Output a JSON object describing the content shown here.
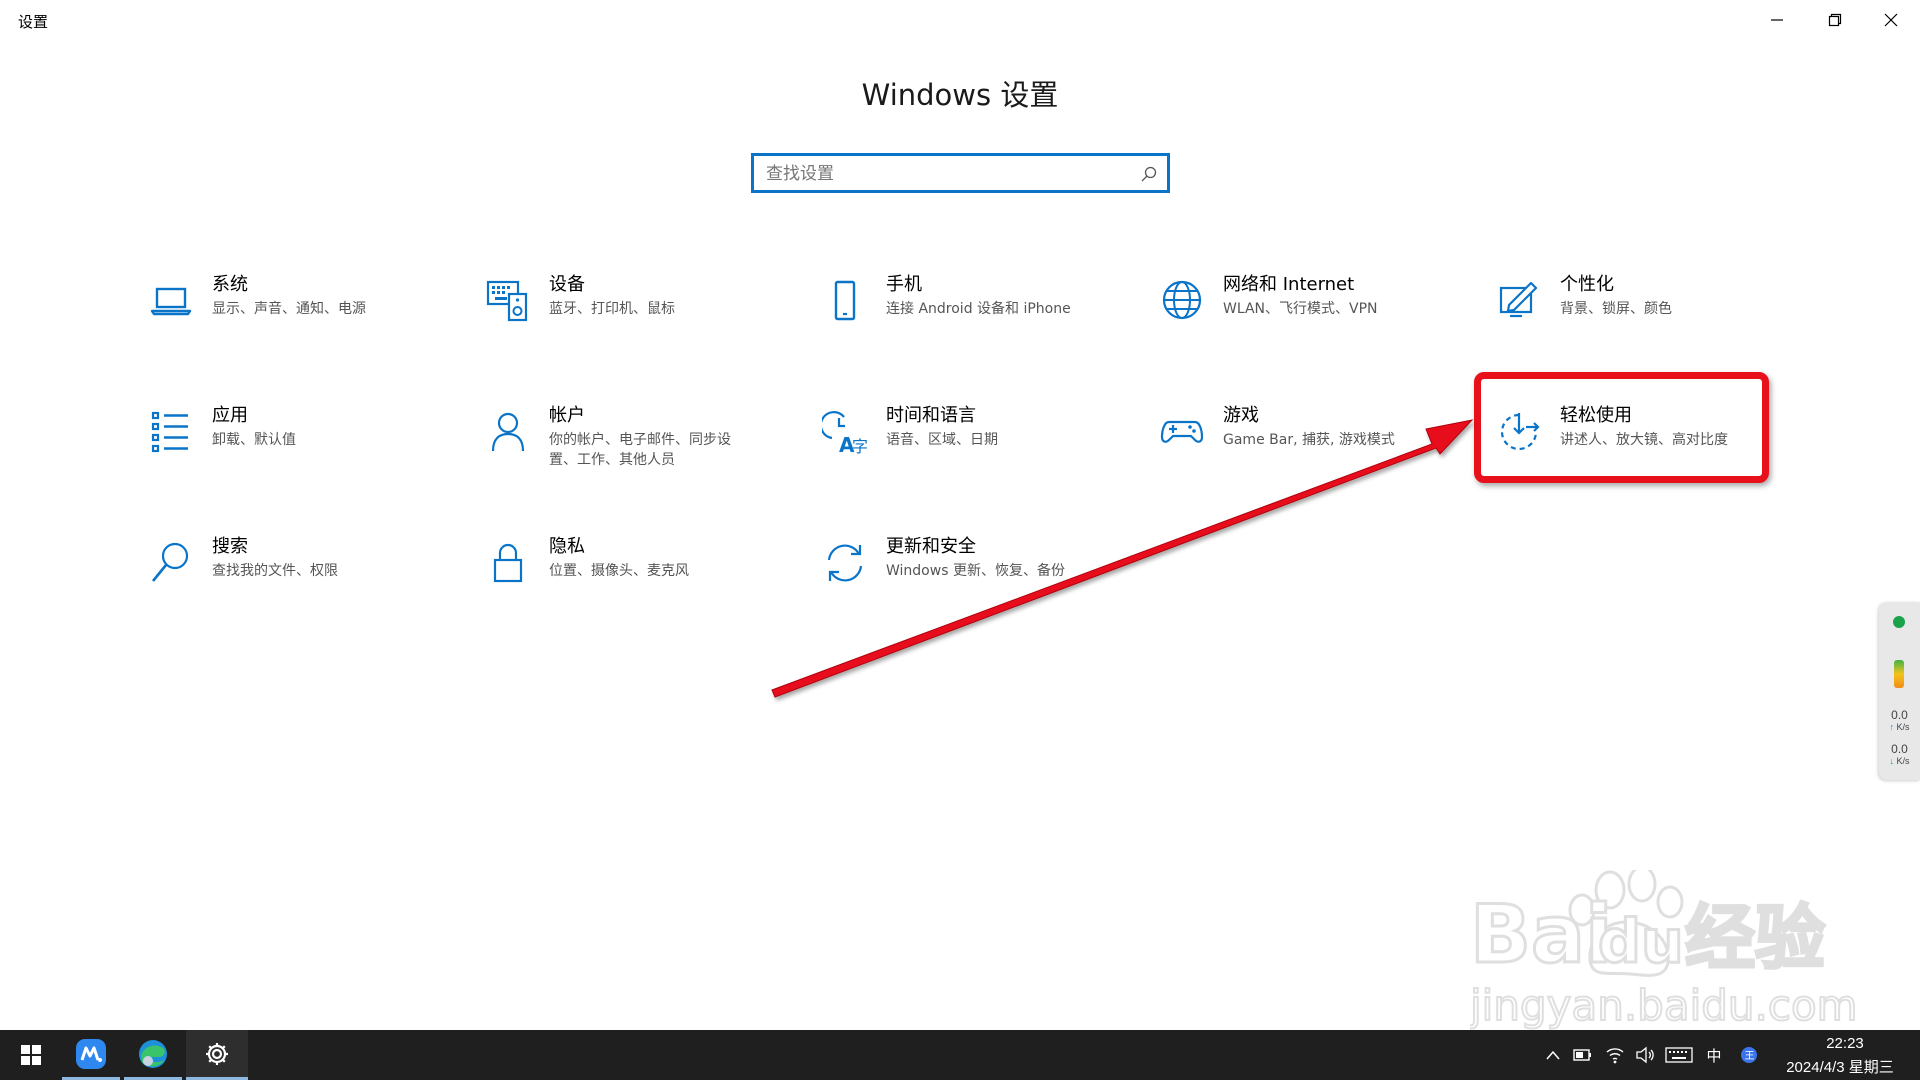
{
  "window": {
    "title": "设置"
  },
  "header": {
    "title": "Windows 设置"
  },
  "search": {
    "placeholder": "查找设置"
  },
  "categories": [
    {
      "title": "系统",
      "subtitle": "显示、声音、通知、电源",
      "icon": "laptop-icon"
    },
    {
      "title": "设备",
      "subtitle": "蓝牙、打印机、鼠标",
      "icon": "devices-icon"
    },
    {
      "title": "手机",
      "subtitle": "连接 Android 设备和 iPhone",
      "icon": "phone-icon"
    },
    {
      "title": "网络和 Internet",
      "subtitle": "WLAN、飞行模式、VPN",
      "icon": "globe-icon"
    },
    {
      "title": "个性化",
      "subtitle": "背景、锁屏、颜色",
      "icon": "personalization-icon"
    },
    {
      "title": "应用",
      "subtitle": "卸载、默认值",
      "icon": "apps-icon"
    },
    {
      "title": "帐户",
      "subtitle": "你的帐户、电子邮件、同步设置、工作、其他人员",
      "icon": "person-icon"
    },
    {
      "title": "时间和语言",
      "subtitle": "语音、区域、日期",
      "icon": "time-language-icon"
    },
    {
      "title": "游戏",
      "subtitle": "Game Bar, 捕获, 游戏模式",
      "icon": "gamepad-icon"
    },
    {
      "title": "轻松使用",
      "subtitle": "讲述人、放大镜、高对比度",
      "icon": "ease-of-access-icon"
    },
    {
      "title": "搜索",
      "subtitle": "查找我的文件、权限",
      "icon": "search-icon"
    },
    {
      "title": "隐私",
      "subtitle": "位置、摄像头、麦克风",
      "icon": "lock-icon"
    },
    {
      "title": "更新和安全",
      "subtitle": "Windows 更新、恢复、备份",
      "icon": "refresh-icon"
    }
  ],
  "annotation": {
    "color": "#e8101a",
    "target": "轻松使用"
  },
  "network_widget": {
    "upload": "0.0",
    "upload_unit": "K/s",
    "download": "0.0",
    "download_unit": "K/s"
  },
  "watermark": {
    "logo_text": "Bai du 经验",
    "url_text": "jingyan.baidu.com"
  },
  "taskbar": {
    "apps": [
      "start-icon",
      "meitu-icon",
      "edge-icon",
      "settings-gear-icon"
    ],
    "ime": "中",
    "time": "22:23",
    "date": "2024/4/3 星期三"
  },
  "colors": {
    "accent": "#0a74c9",
    "taskbar": "#1f1f1f"
  }
}
